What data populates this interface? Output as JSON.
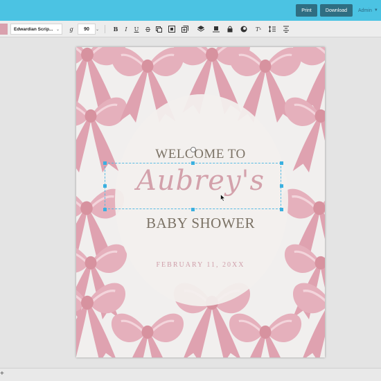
{
  "topbar": {
    "print_label": "Print",
    "download_label": "Download",
    "admin_label": "Admin",
    "accent_color": "#4bc3e3"
  },
  "toolbar": {
    "swatch_color": "#d9a0ad",
    "font_name": "Edwardian Scrip...",
    "font_size": "90",
    "icons": [
      "text-style-icon",
      "bold-icon",
      "italic-icon",
      "underline-icon",
      "strikethrough-icon",
      "duplicate-icon",
      "layers-icon",
      "arrange-icon",
      "lock-icon",
      "color-fill-icon",
      "clear-format-icon",
      "line-spacing-icon",
      "align-icon"
    ]
  },
  "document": {
    "welcome": "WELCOME TO",
    "name": "Aubrey's",
    "event": "BABY SHOWER",
    "date": "FEBRUARY 11, 20XX"
  },
  "bottombar": {
    "add_label": "+"
  }
}
